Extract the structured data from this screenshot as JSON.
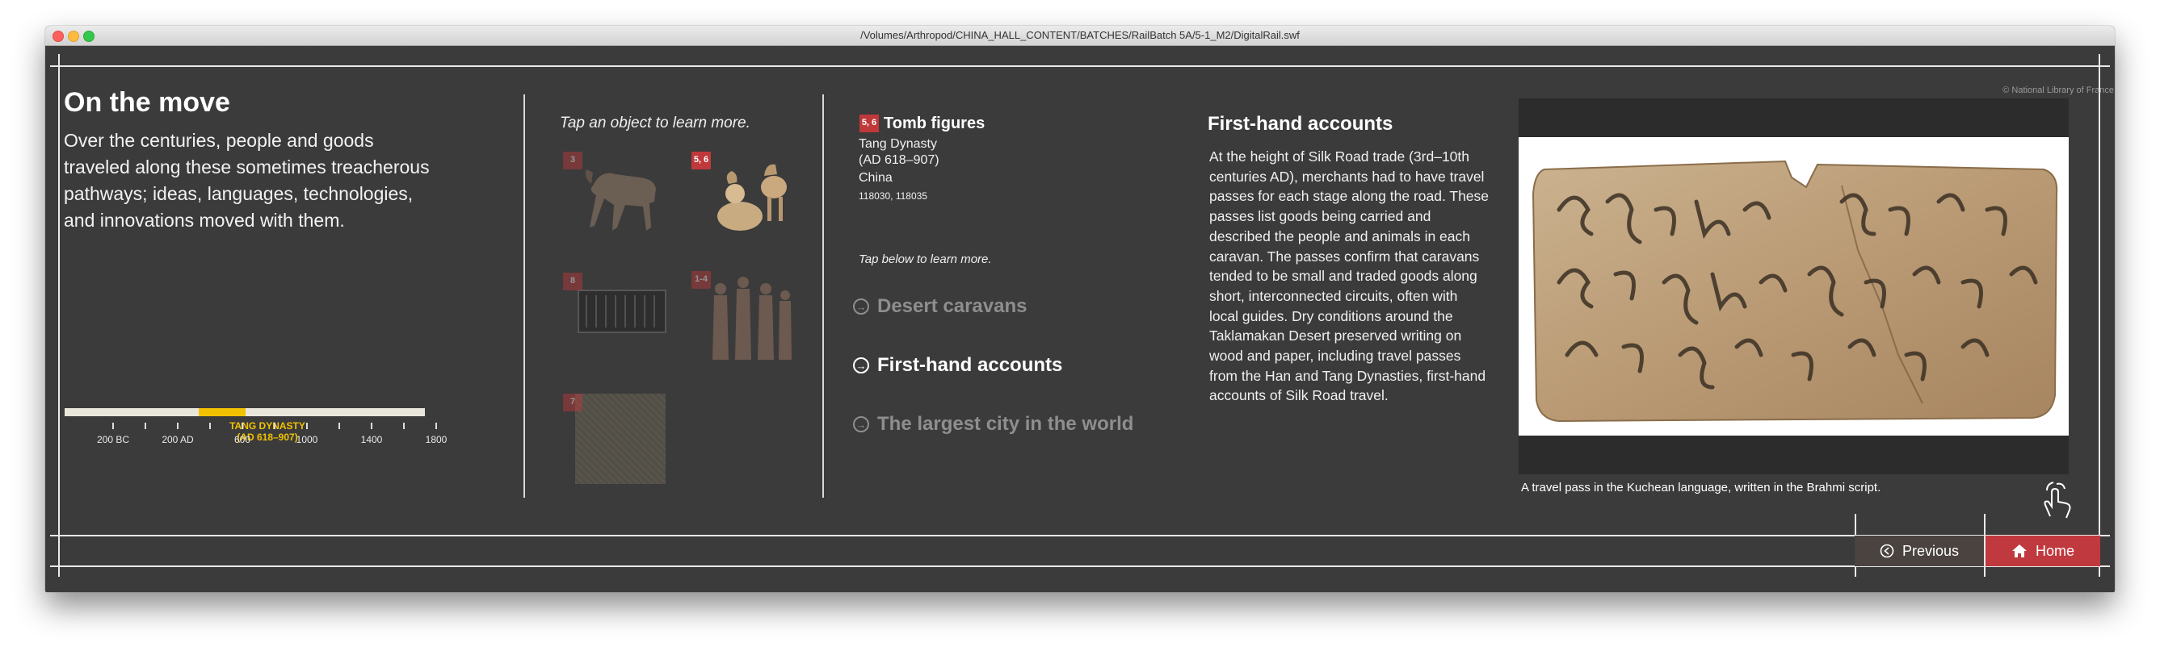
{
  "window": {
    "title": "/Volumes/Arthropod/CHINA_HALL_CONTENT/BATCHES/RailBatch 5A/5-1_M2/DigitalRail.swf"
  },
  "intro": {
    "title": "On the move",
    "body": "Over the centuries, people and goods traveled along these sometimes treacherous pathways; ideas, languages, technologies, and innovations moved with them."
  },
  "timeline": {
    "era_name": "TANG DYNASTY",
    "era_dates": "(AD 618–907)",
    "range_start_year": -200,
    "range_end_year": 2000,
    "highlight_start_year": 618,
    "highlight_end_year": 907,
    "tick_labels": [
      "200 BC",
      "200 AD",
      "600",
      "1000",
      "1400",
      "1800"
    ]
  },
  "objects": {
    "hint": "Tap an object to learn more.",
    "thumbs": [
      {
        "badge": "3",
        "selected": false
      },
      {
        "badge": "5, 6",
        "selected": true
      },
      {
        "badge": "8",
        "selected": false
      },
      {
        "badge": "1-4",
        "selected": false
      },
      {
        "badge": "7",
        "selected": false
      }
    ]
  },
  "detail": {
    "badge": "5, 6",
    "title": "Tomb figures",
    "dynasty": "Tang Dynasty",
    "dates": "(AD 618–907)",
    "origin": "China",
    "catalog": "118030, 118035",
    "tap_hint": "Tap below to learn more.",
    "links": [
      {
        "label": "Desert caravans",
        "active": false
      },
      {
        "label": "First-hand accounts",
        "active": true
      },
      {
        "label": "The largest city in the world",
        "active": false
      }
    ]
  },
  "accounts": {
    "heading": "First-hand accounts",
    "body": "At the height of Silk Road trade (3rd–10th centuries AD), merchants had to have travel passes for each stage along the road. These passes list goods being carried and described the people and animals in each caravan. The passes confirm that caravans tended to be small and traded goods along short, interconnected circuits, often with local guides. Dry conditions around the Taklamakan Desert preserved writing on wood and paper, including travel passes from the Han and Tang Dynasties, first-hand accounts of Silk Road travel."
  },
  "image": {
    "credit": "© National Library of France",
    "caption": "A travel pass in the Kuchean language, written in the Brahmi script."
  },
  "nav": {
    "previous": "Previous",
    "home": "Home"
  },
  "colors": {
    "background": "#3b3b3b",
    "accent_red": "#c0393e",
    "timeline_highlight": "#f2c200"
  }
}
